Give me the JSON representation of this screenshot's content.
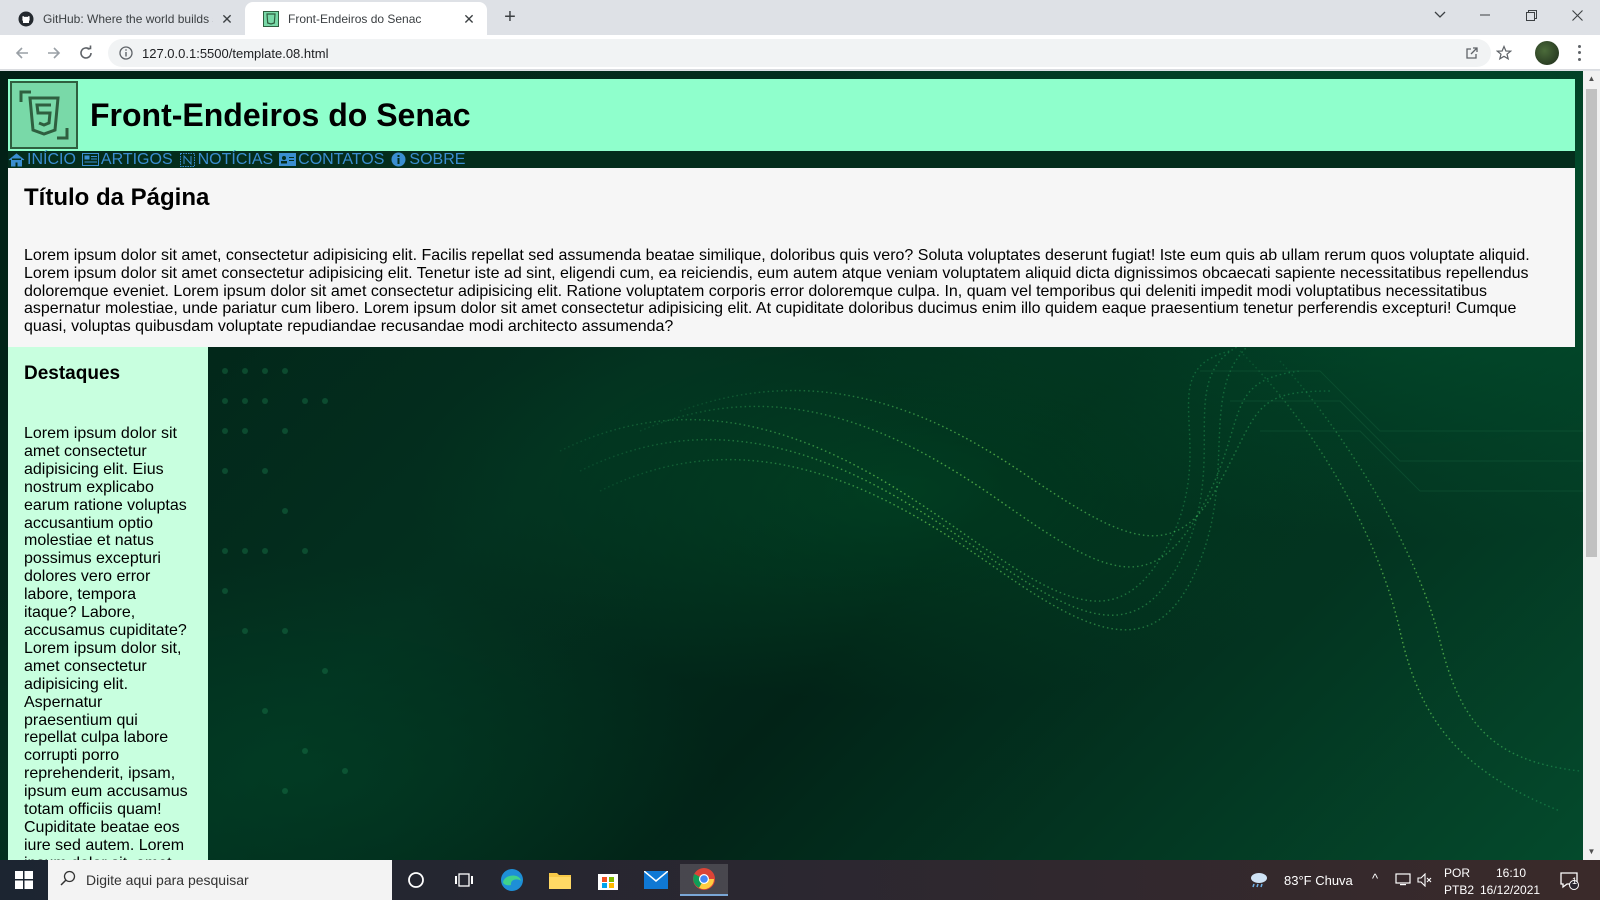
{
  "browser": {
    "tabs": [
      {
        "title": "GitHub: Where the world builds s",
        "active": false
      },
      {
        "title": "Front-Endeiros do Senac",
        "active": true
      }
    ],
    "url": "127.0.0.1:5500/template.08.html"
  },
  "site": {
    "title": "Front-Endeiros do Senac",
    "logo_icon": "html5-icon",
    "menu": [
      {
        "icon": "home-icon",
        "label": "INÍCIO"
      },
      {
        "icon": "newspaper-icon",
        "label": "ARTIGOS"
      },
      {
        "icon": "news-icon",
        "label": "NOTÍCIAS"
      },
      {
        "icon": "contact-card-icon",
        "label": "CONTATOS"
      },
      {
        "icon": "info-icon",
        "label": "SOBRE"
      }
    ]
  },
  "main": {
    "heading": "Título da Página",
    "text": "Lorem ipsum dolor sit amet, consectetur adipisicing elit. Facilis repellat sed assumenda beatae similique, doloribus quis vero? Soluta voluptates deserunt fugiat! Iste eum quis ab ullam rerum quos voluptate aliquid. Lorem ipsum dolor sit amet consectetur adipisicing elit. Tenetur iste ad sint, eligendi cum, ea reiciendis, eum autem atque veniam voluptatem aliquid dicta dignissimos obcaecati sapiente necessitatibus repellendus doloremque eveniet. Lorem ipsum dolor sit amet consectetur adipisicing elit. Ratione voluptatem corporis error doloremque culpa. In, quam vel temporibus qui deleniti impedit modi voluptatibus necessitatibus aspernatur molestiae, unde pariatur cum libero. Lorem ipsum dolor sit amet consectetur adipisicing elit. At cupiditate doloribus ducimus enim illo quidem eaque praesentium tenetur perferendis excepturi! Cumque quasi, voluptas quibusdam voluptate repudiandae recusandae modi architecto assumenda?"
  },
  "aside": {
    "heading": "Destaques",
    "text": "Lorem ipsum dolor sit amet consectetur adipisicing elit. Eius nostrum explicabo earum ratione voluptas accusantium optio molestiae et natus possimus excepturi dolores vero error labore, tempora itaque? Labore, accusamus cupiditate? Lorem ipsum dolor sit, amet consectetur adipisicing elit. Aspernatur praesentium qui repellat culpa labore corrupti porro reprehenderit, ipsam, ipsum eum accusamus totam officiis quam! Cupiditate beatae eos iure sed autem. Lorem ipsum dolor sit, amet"
  },
  "taskbar": {
    "search_placeholder": "Digite aqui para pesquisar",
    "weather": "83°F  Chuva",
    "lang_top": "POR",
    "lang_bottom": "PTB2",
    "time": "16:10",
    "date": "16/12/2021",
    "notifications": "1"
  },
  "colors": {
    "header_bg": "#8fffcc",
    "aside_bg": "#c8ffdf",
    "menu_link": "#3a8ed0",
    "menu_bg": "#042d1c"
  }
}
